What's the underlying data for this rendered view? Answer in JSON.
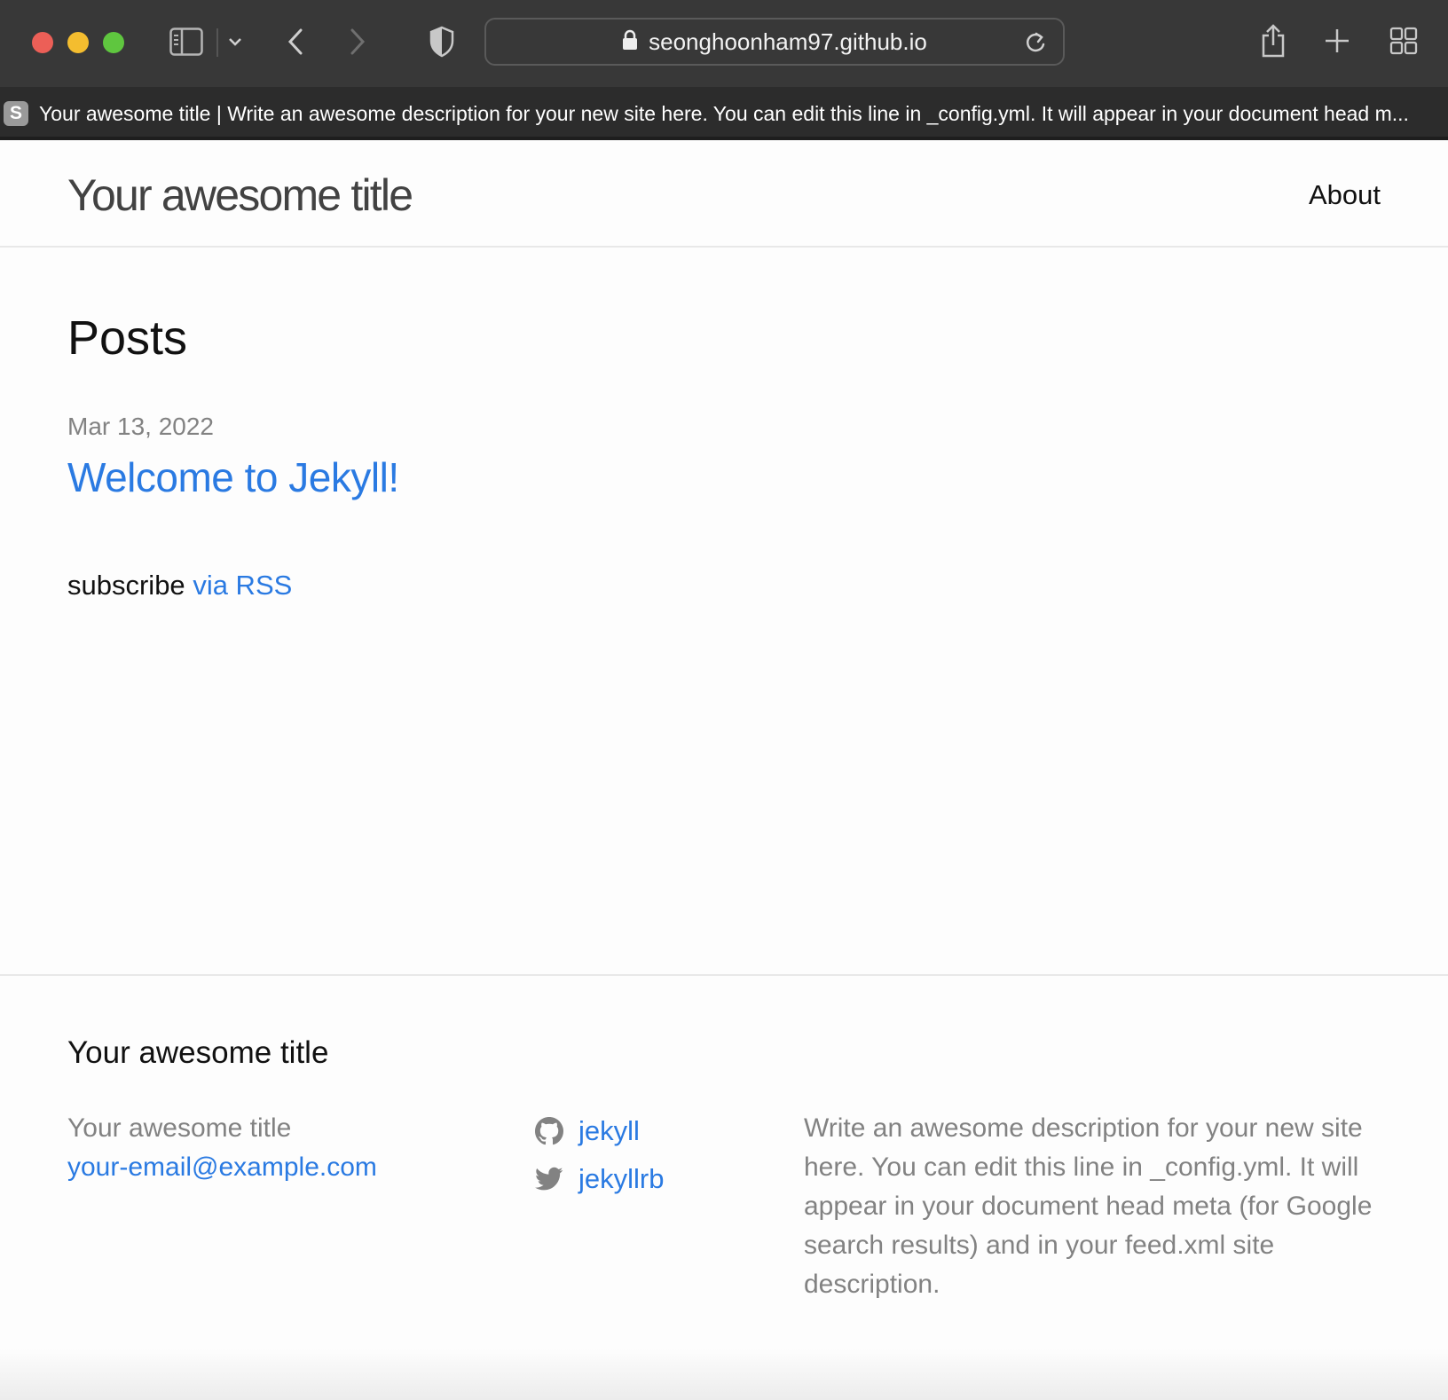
{
  "browser": {
    "url": "seonghoonham97.github.io",
    "tab_favicon_letter": "S",
    "tab_title": "Your awesome title | Write an awesome description for your new site here. You can edit this line in _config.yml. It will appear in your document head m..."
  },
  "header": {
    "site_title": "Your awesome title",
    "nav_about": "About"
  },
  "main": {
    "heading": "Posts",
    "posts": [
      {
        "date": "Mar 13, 2022",
        "title": "Welcome to Jekyll!"
      }
    ],
    "rss_prefix": "subscribe",
    "rss_link": "via RSS"
  },
  "footer": {
    "heading": "Your awesome title",
    "name": "Your awesome title",
    "email": "your-email@example.com",
    "github_user": "jekyll",
    "twitter_user": "jekyllrb",
    "description": "Write an awesome description for your new site here. You can edit this line in _config.yml. It will appear in your document head meta (for Google search results) and in your feed.xml site description."
  },
  "colors": {
    "link": "#2a7ae2",
    "muted": "#828282",
    "chrome": "#383838"
  }
}
